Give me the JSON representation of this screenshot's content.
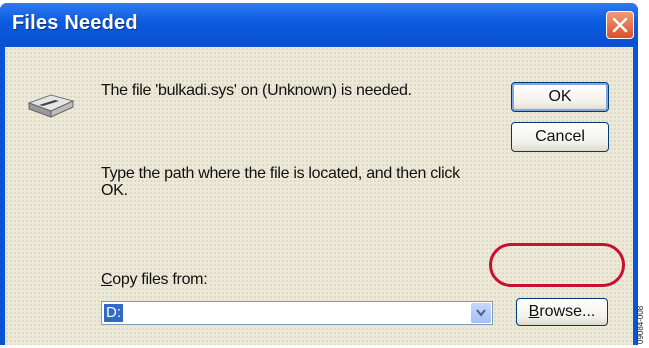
{
  "window": {
    "title": "Files Needed"
  },
  "message": {
    "file_needed": "The file 'bulkadi.sys' on (Unknown) is needed.",
    "instruction": "Type the path where the file is located, and then click OK."
  },
  "buttons": {
    "ok": "OK",
    "cancel": "Cancel",
    "browse_u": "B",
    "browse_rest": "rowse..."
  },
  "copy_from": {
    "label_u": "C",
    "label_rest": "opy files from:",
    "value": "D:"
  },
  "figure_id": "09084-008",
  "colors": {
    "title_bar": "#0a54d6",
    "close_button": "#d9512a",
    "highlight_ring": "#c8102e",
    "selection": "#316ac5"
  },
  "icons": {
    "drive": "floppy-drive-icon",
    "close": "close-icon",
    "dropdown": "chevron-down-icon"
  }
}
